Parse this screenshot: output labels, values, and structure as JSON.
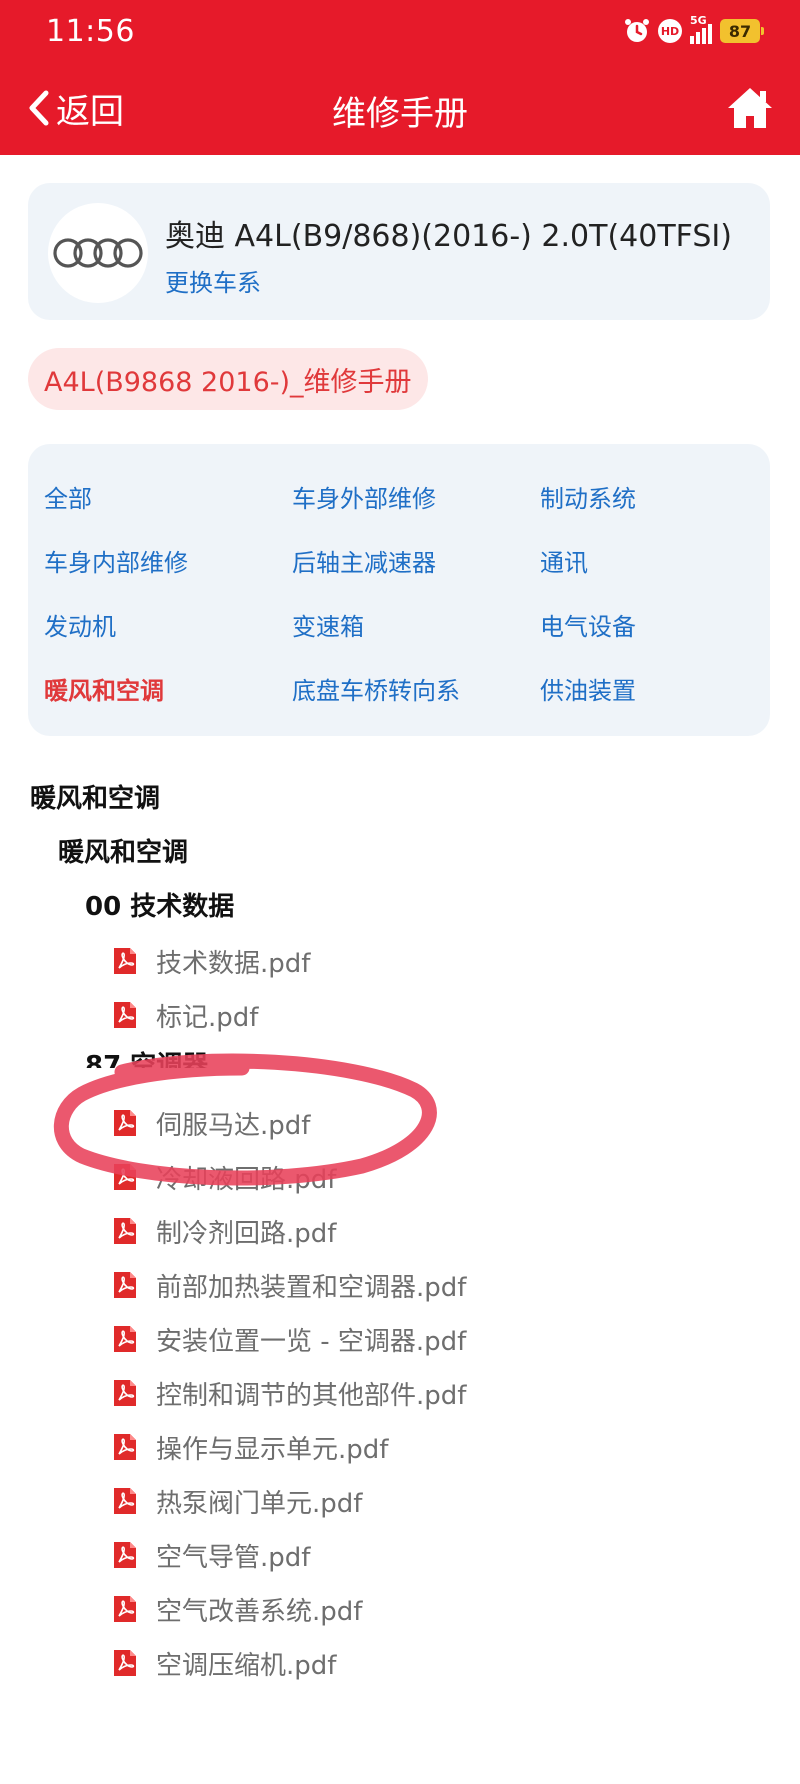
{
  "status_bar": {
    "time": "11:56",
    "hd_label": "HD",
    "network_label": "5G",
    "battery": "87",
    "icons": [
      "alarm-icon",
      "hd-icon",
      "signal-icon",
      "battery-icon"
    ]
  },
  "navbar": {
    "back_label": "返回",
    "title": "维修手册",
    "icons": [
      "chevron-left-icon",
      "home-icon"
    ]
  },
  "vehicle": {
    "name": "奥迪 A4L(B9/868)(2016-) 2.0T(40TFSI)",
    "change_label": "更换车系",
    "logo": "audi-rings-logo"
  },
  "manual_tag": "A4L(B9868 2016-)_维修手册",
  "categories": [
    {
      "label": "全部",
      "active": false
    },
    {
      "label": "车身外部维修",
      "active": false
    },
    {
      "label": "制动系统",
      "active": false
    },
    {
      "label": "车身内部维修",
      "active": false
    },
    {
      "label": "后轴主减速器",
      "active": false
    },
    {
      "label": "通讯",
      "active": false
    },
    {
      "label": "发动机",
      "active": false
    },
    {
      "label": "变速箱",
      "active": false
    },
    {
      "label": "电气设备",
      "active": false
    },
    {
      "label": "暖风和空调",
      "active": true
    },
    {
      "label": "底盘车桥转向系",
      "active": false
    },
    {
      "label": "供油装置",
      "active": false
    }
  ],
  "colors": {
    "brand_red": "#e61a2a",
    "link_blue": "#1f6fc6",
    "active_red": "#e0393b",
    "annotation_red": "#e8415a"
  },
  "tree": {
    "section": "暖风和空调",
    "subsection": "暖风和空调",
    "group1": {
      "title": "00 技术数据",
      "files": [
        "技术数据.pdf",
        "标记.pdf"
      ]
    },
    "group2": {
      "title": "87 空调器",
      "files": [
        "伺服马达.pdf",
        "冷却液回路.pdf",
        "制冷剂回路.pdf",
        "前部加热装置和空调器.pdf",
        "安装位置一览 - 空调器.pdf",
        "控制和调节的其他部件.pdf",
        "操作与显示单元.pdf",
        "热泵阀门单元.pdf",
        "空气导管.pdf",
        "空气改善系统.pdf",
        "空调压缩机.pdf"
      ]
    }
  }
}
